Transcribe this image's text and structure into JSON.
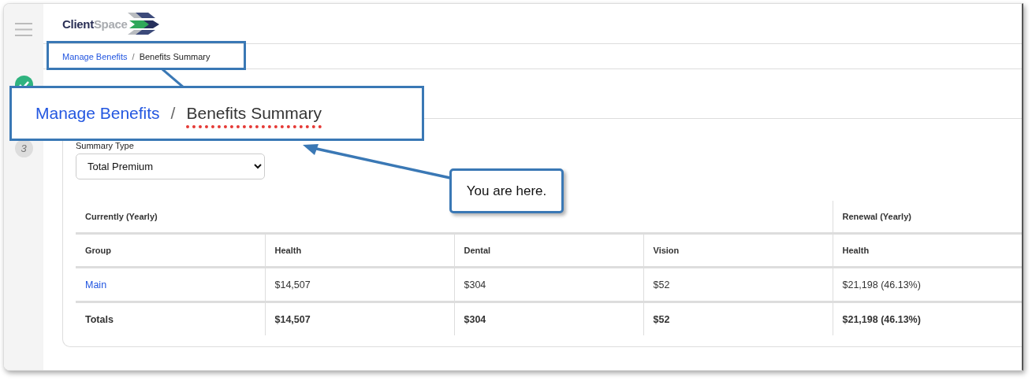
{
  "logo": {
    "primary": "Client",
    "secondary": "Space"
  },
  "steps": [
    {
      "kind": "done"
    },
    {
      "kind": "number",
      "label": "3"
    }
  ],
  "breadcrumb": {
    "separator": "/",
    "items": [
      {
        "label": "Manage Benefits",
        "kind": "link"
      },
      {
        "label": "Benefits Summary",
        "kind": "current"
      }
    ]
  },
  "summary_type": {
    "label": "Summary Type",
    "value": "Total Premium"
  },
  "table": {
    "column_groups": [
      {
        "label": "Currently (Yearly)",
        "columns": [
          "Group",
          "Health",
          "Dental",
          "Vision"
        ]
      },
      {
        "label": "Renewal (Yearly)",
        "columns": [
          "Health"
        ]
      }
    ],
    "rows": [
      {
        "kind": "data",
        "cells": [
          "Main",
          "$14,507",
          "$304",
          "$52",
          "$21,198 (46.13%)"
        ]
      },
      {
        "kind": "totals",
        "cells": [
          "Totals",
          "$14,507",
          "$304",
          "$52",
          "$21,198 (46.13%)"
        ]
      }
    ]
  },
  "annotation": {
    "zoomed_breadcrumb": {
      "separator": "/",
      "items": [
        {
          "label": "Manage Benefits",
          "kind": "link"
        },
        {
          "label": "Benefits Summary",
          "kind": "current"
        }
      ]
    },
    "callout": "You are here."
  }
}
